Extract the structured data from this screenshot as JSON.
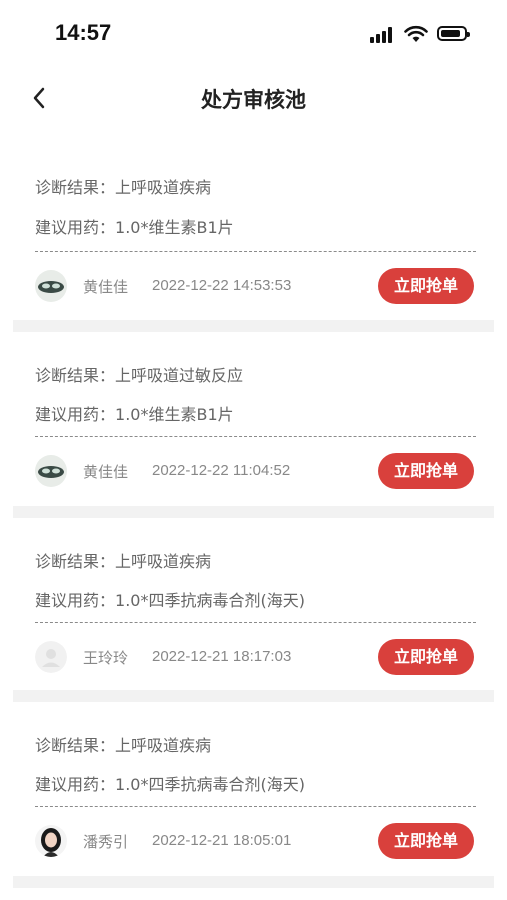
{
  "status_bar": {
    "time": "14:57"
  },
  "nav": {
    "title": "处方审核池"
  },
  "labels": {
    "diagnosis": "诊断结果：",
    "medication": "建议用药："
  },
  "cards": [
    {
      "diagnosis": "上呼吸道疾病",
      "medication": "1.0*维生素B1片",
      "doctor": "黄佳佳",
      "time": "2022-12-22 14:53:53",
      "button": "立即抢单",
      "avatar": "doctor-avatar-icon"
    },
    {
      "diagnosis": "上呼吸道过敏反应",
      "medication": "1.0*维生素B1片",
      "doctor": "黄佳佳",
      "time": "2022-12-22 11:04:52",
      "button": "立即抢单",
      "avatar": "doctor-avatar-icon"
    },
    {
      "diagnosis": "上呼吸道疾病",
      "medication": "1.0*四季抗病毒合剂(海天)",
      "doctor": "王玲玲",
      "time": "2022-12-21 18:17:03",
      "button": "立即抢单",
      "avatar": "default-avatar-icon"
    },
    {
      "diagnosis": "上呼吸道疾病",
      "medication": "1.0*四季抗病毒合剂(海天)",
      "doctor": "潘秀引",
      "time": "2022-12-21 18:05:01",
      "button": "立即抢单",
      "avatar": "woman-avatar-icon"
    }
  ],
  "colors": {
    "accent": "#d9403c",
    "separator": "#f2f2f2"
  }
}
